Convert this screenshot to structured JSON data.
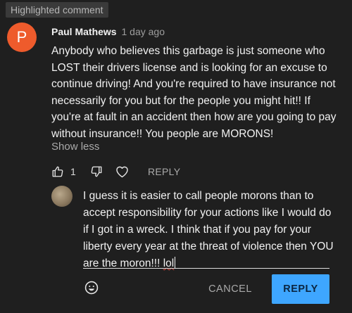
{
  "badge": "Highlighted comment",
  "comment": {
    "avatar_letter": "P",
    "author": "Paul Mathews",
    "timestamp": "1 day ago",
    "text": "Anybody who believes this garbage is just someone who LOST their drivers license and is looking for an excuse to continue driving! And you're required to have insurance not necessarily for you but for the people you might hit!! If you're at fault in an accident then how are you going to pay without insurance!! You people are MORONS!",
    "show_less_label": "Show less",
    "like_count": "1",
    "reply_label": "REPLY"
  },
  "reply_box": {
    "text": "I guess it is easier to call people morons than to accept responsibility for your actions like I would do if I got in a wreck. I think that if you pay for your liberty every year at the threat of violence then YOU are the moron!!!",
    "typo_word": "lol",
    "cancel_label": "CANCEL",
    "submit_label": "REPLY"
  },
  "colors": {
    "background": "#1f1f1f",
    "avatar": "#ee5b2c",
    "reply_button": "#3ea6ff",
    "spellcheck": "#e0463c"
  },
  "icons": [
    "thumbs-up-icon",
    "thumbs-down-icon",
    "heart-icon",
    "emoji-icon"
  ]
}
